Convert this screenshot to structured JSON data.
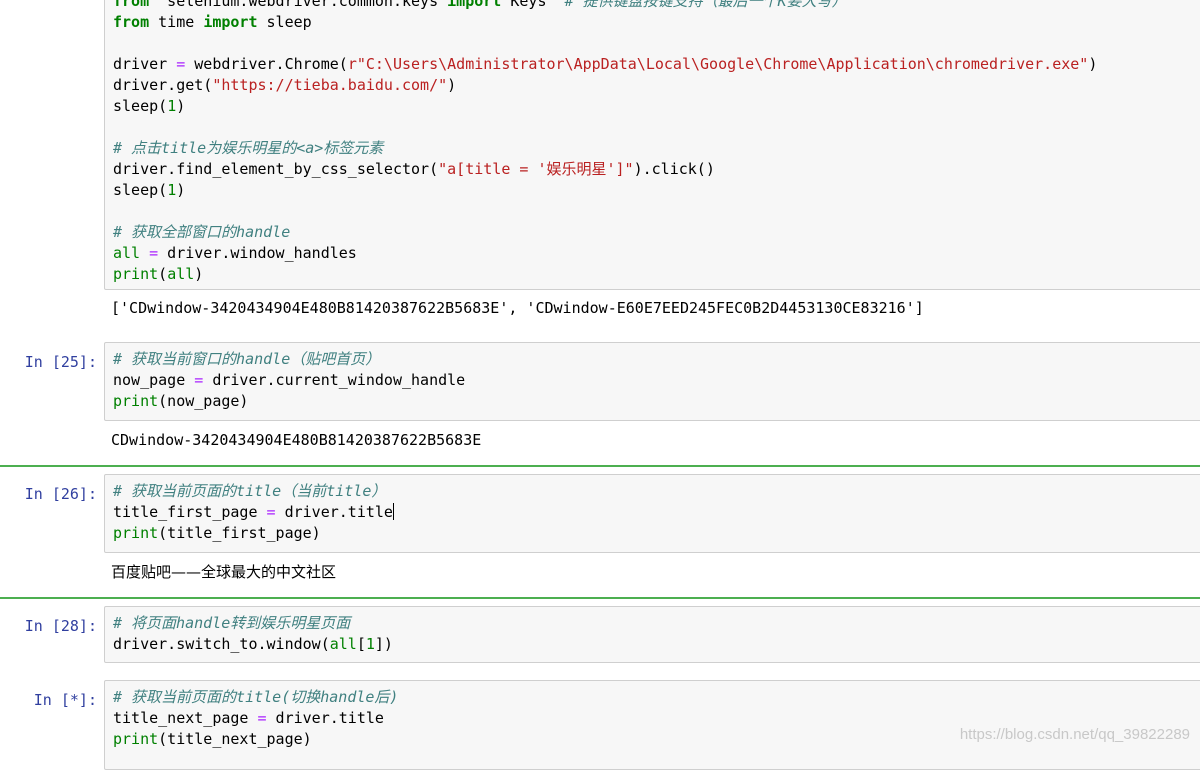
{
  "cells": [
    {
      "prompt": "",
      "lines": [
        [
          [
            "kw",
            "from"
          ],
          [
            "",
            "  selenium.webdriver.common.keys "
          ],
          [
            "kw",
            "import"
          ],
          [
            "",
            " Keys  "
          ],
          [
            "cm",
            "# 提供键盘按键支持（最后一个K要大写）"
          ]
        ],
        [
          [
            "kw",
            "from"
          ],
          [
            "",
            " time "
          ],
          [
            "kw",
            "import"
          ],
          [
            "",
            " sleep"
          ]
        ],
        [
          [
            "",
            ""
          ]
        ],
        [
          [
            "",
            "driver "
          ],
          [
            "op",
            "="
          ],
          [
            "",
            " webdriver.Chrome("
          ],
          [
            "st",
            "r\"C:\\Users\\Administrator\\AppData\\Local\\Google\\Chrome\\Application\\chromedriver.exe\""
          ],
          [
            "",
            ")"
          ]
        ],
        [
          [
            "",
            "driver.get("
          ],
          [
            "st",
            "\"https://tieba.baidu.com/\""
          ],
          [
            "",
            ")"
          ]
        ],
        [
          [
            "",
            "sleep("
          ],
          [
            "bi",
            "1"
          ],
          [
            "",
            ")"
          ]
        ],
        [
          [
            "",
            ""
          ]
        ],
        [
          [
            "cm",
            "# 点击title为娱乐明星的<a>标签元素"
          ]
        ],
        [
          [
            "",
            "driver.find_element_by_css_selector("
          ],
          [
            "st",
            "\"a[title = '娱乐明星']\""
          ],
          [
            "",
            ").click()"
          ]
        ],
        [
          [
            "",
            "sleep("
          ],
          [
            "bi",
            "1"
          ],
          [
            "",
            ")"
          ]
        ],
        [
          [
            "",
            ""
          ]
        ],
        [
          [
            "cm",
            "# 获取全部窗口的handle"
          ]
        ],
        [
          [
            "bi",
            "all"
          ],
          [
            "",
            " "
          ],
          [
            "op",
            "="
          ],
          [
            "",
            " driver.window_handles"
          ]
        ],
        [
          [
            "bi",
            "print"
          ],
          [
            "",
            "("
          ],
          [
            "bi",
            "all"
          ],
          [
            "",
            ")"
          ]
        ]
      ],
      "output": "['CDwindow-3420434904E480B81420387622B5683E', 'CDwindow-E60E7EED245FEC0B2D4453130CE83216']"
    },
    {
      "prompt": "In  [25]:",
      "lines": [
        [
          [
            "cm",
            "# 获取当前窗口的handle（贴吧首页）"
          ]
        ],
        [
          [
            "",
            "now_page "
          ],
          [
            "op",
            "="
          ],
          [
            "",
            " driver.current_window_handle"
          ]
        ],
        [
          [
            "bi",
            "print"
          ],
          [
            "",
            "(now_page)"
          ]
        ]
      ],
      "output": "CDwindow-3420434904E480B81420387622B5683E"
    },
    {
      "prompt": "In  [26]:",
      "lines": [
        [
          [
            "cm",
            "# 获取当前页面的title（当前title）"
          ]
        ],
        [
          [
            "",
            "title_first_page "
          ],
          [
            "op",
            "="
          ],
          [
            "",
            " driver.title"
          ]
        ],
        [
          [
            "bi",
            "print"
          ],
          [
            "",
            "(title_first_page)"
          ]
        ]
      ],
      "output": "百度贴吧——全球最大的中文社区"
    },
    {
      "prompt": "In  [28]:",
      "lines": [
        [
          [
            "cm",
            "# 将页面handle转到娱乐明星页面"
          ]
        ],
        [
          [
            "",
            "driver.switch_to.window("
          ],
          [
            "bi",
            "all"
          ],
          [
            "",
            "["
          ],
          [
            "bi",
            "1"
          ],
          [
            "",
            "])"
          ]
        ]
      ],
      "output": ""
    },
    {
      "prompt": "In  [*]:",
      "lines": [
        [
          [
            "cm",
            "# 获取当前页面的title(切换handle后)"
          ]
        ],
        [
          [
            "",
            "title_next_page "
          ],
          [
            "op",
            "="
          ],
          [
            "",
            " driver.title"
          ]
        ],
        [
          [
            "bi",
            "print"
          ],
          [
            "",
            "(title_next_page)"
          ]
        ]
      ],
      "output": ""
    }
  ],
  "watermark": "https://blog.csdn.net/qq_39822289"
}
